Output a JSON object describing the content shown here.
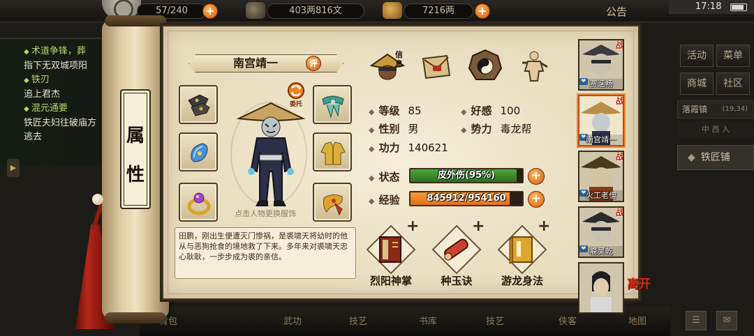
{
  "topbar": {
    "stamina": "57/240",
    "copper": "403两816文",
    "silver": "7216两",
    "notice": "公告",
    "time": "17:18"
  },
  "quests": [
    {
      "title": "术道争锋，葬",
      "desc": "指下无双城项阳"
    },
    {
      "title": "铁刃",
      "desc": "追上君杰"
    },
    {
      "title": "混元通要",
      "desc": "铁匠夫妇往破庙方"
    },
    {
      "title": "",
      "desc": "逃去"
    }
  ],
  "right_menu": {
    "buttons": [
      "活动",
      "菜单",
      "商城",
      "社区"
    ],
    "location": "落霞镇",
    "coords": "(19,34)",
    "sub_location": "中 西 入",
    "smith_label": "铁匠铺"
  },
  "bottom_bar": [
    "背包",
    "武功",
    "技艺",
    "书库",
    "技艺",
    "侠客",
    "地图"
  ],
  "scroll_tag": {
    "char1": "属",
    "char2": "性"
  },
  "character": {
    "name": "南宫靖一",
    "eval_label": "评",
    "entrust_label": "委托",
    "change_hint": "点击人物更换服饰",
    "bio": "田鹏，刚出生便遭灭门惨祸，是裘啸天将幼时的他从与恶狗抢食的境地救了下来。多年来对裘啸天忠心耿耿，一步步成为裘的亲信。"
  },
  "equipment": [
    {
      "slot": "hands",
      "icon": "bracer-icon"
    },
    {
      "slot": "neck",
      "icon": "scarf-icon"
    },
    {
      "slot": "hidden-weapon",
      "icon": "jade-pendant-icon"
    },
    {
      "slot": "armor",
      "icon": "robe-icon"
    },
    {
      "slot": "ring",
      "icon": "ring-icon"
    },
    {
      "slot": "accessory",
      "icon": "sash-icon"
    }
  ],
  "tabs": [
    {
      "name": "info",
      "label": "信息",
      "icon": "hat-icon"
    },
    {
      "name": "letter",
      "icon": "letter-icon"
    },
    {
      "name": "bagua",
      "icon": "bagua-icon"
    },
    {
      "name": "meridian",
      "icon": "body-icon"
    }
  ],
  "stats": {
    "level_label": "等级",
    "level": "85",
    "favor_label": "好感",
    "favor": "100",
    "gender_label": "性别",
    "gender": "男",
    "faction_label": "势力",
    "faction": "毒龙帮",
    "power_label": "功力",
    "power": "140621"
  },
  "status": {
    "label": "状态",
    "text": "皮外伤(95%)",
    "percent": 95,
    "color": "#4fa83a"
  },
  "exp": {
    "label": "经验",
    "text": "845912/954160",
    "current": 845912,
    "max": 954160,
    "color": "#e2701a"
  },
  "skills": [
    {
      "name": "烈阳神掌",
      "icon": "palm-book-icon"
    },
    {
      "name": "种玉诀",
      "icon": "scroll-icon"
    },
    {
      "name": "游龙身法",
      "icon": "manual-icon"
    }
  ],
  "companions": [
    {
      "name": "贾涵畅",
      "battle": "战",
      "active": false
    },
    {
      "name": "南宫靖一",
      "battle": "战",
      "active": true
    },
    {
      "name": "火工老僧",
      "battle": "战",
      "active": false
    },
    {
      "name": "裔昊乾",
      "battle": "战",
      "active": false
    },
    {
      "name": "",
      "battle": "",
      "active": false
    }
  ],
  "leave_label": "离开"
}
